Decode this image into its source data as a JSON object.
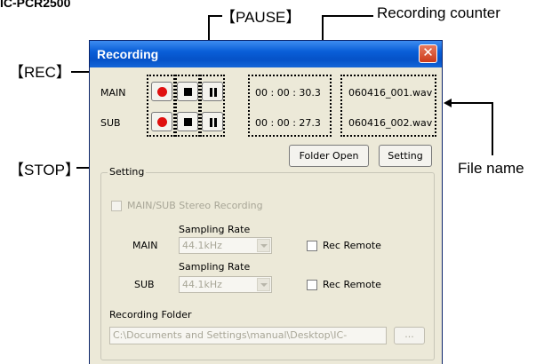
{
  "header_partial": "IC-PCR2500",
  "callouts": {
    "pause": "【PAUSE】",
    "recording_counter": "Recording counter",
    "rec": "【REC】",
    "stop": "【STOP】",
    "file_name": "File name"
  },
  "window": {
    "title": "Recording",
    "close_glyph": "✕"
  },
  "channels": [
    {
      "label": "MAIN",
      "counter": "00 : 00 : 30.3",
      "file": "060416_001.wav"
    },
    {
      "label": "SUB",
      "counter": "00 : 00 : 27.3",
      "file": "060416_002.wav"
    }
  ],
  "buttons": {
    "folder_open": "Folder Open",
    "setting": "Setting",
    "browse": "..."
  },
  "setting_group": {
    "title": "Setting",
    "stereo_label": "MAIN/SUB Stereo Recording",
    "sampling_rate_label": "Sampling Rate",
    "main_label": "MAIN",
    "sub_label": "SUB",
    "main_rate": "44.1kHz",
    "sub_rate": "44.1kHz",
    "rec_remote": "Rec Remote",
    "folder_label": "Recording Folder",
    "folder_path": "C:\\Documents and Settings\\manual\\Desktop\\IC-"
  }
}
